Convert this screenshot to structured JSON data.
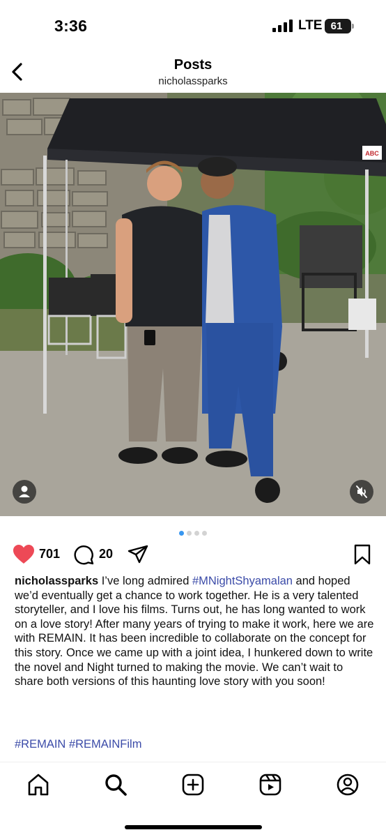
{
  "status_bar": {
    "time": "3:36",
    "network": "LTE",
    "battery": "61"
  },
  "header": {
    "title": "Posts",
    "subtitle": "nicholassparks"
  },
  "post": {
    "carousel": {
      "count": 4,
      "active_index": 0
    },
    "likes": "701",
    "comments": "20",
    "caption": {
      "username": "nicholassparks",
      "text_before": " I’ve long admired ",
      "mention_hashtag": "#MNightShyamalan",
      "text_after": " and hoped we’d eventually get a chance to work together. He is a very talented storyteller, and I love his films. Turns out, he has long wanted to work on a love story! After many years of trying to make it work, here we are with REMAIN. It has been incredible to collaborate on the concept for this story. Once we came up with a joint idea, I hunkered down to write the novel and Night turned to making the movie. We can’t wait to share both versions of this haunting love story with you soon!"
    },
    "hashtags": [
      "#REMAIN",
      "#REMAINFilm"
    ],
    "photo_tent_label": "ABC"
  },
  "nav": {
    "items": [
      "home-icon",
      "search-icon",
      "create-icon",
      "reels-icon",
      "profile-icon"
    ]
  },
  "colors": {
    "like_red": "#ed4956",
    "hashtag_blue": "#3b4ba8",
    "dot_active": "#3897f0"
  }
}
